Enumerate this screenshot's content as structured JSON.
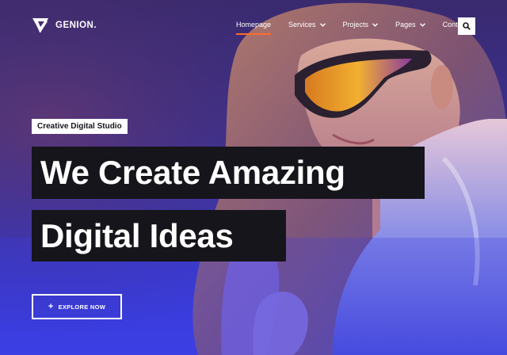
{
  "brand": {
    "name": "GENION."
  },
  "nav": {
    "items": [
      {
        "label": "Homepage",
        "active": true,
        "has_dropdown": false
      },
      {
        "label": "Services",
        "active": false,
        "has_dropdown": true
      },
      {
        "label": "Projects",
        "active": false,
        "has_dropdown": true
      },
      {
        "label": "Pages",
        "active": false,
        "has_dropdown": true
      },
      {
        "label": "Contact",
        "active": false,
        "has_dropdown": false
      }
    ],
    "search_icon": "search-icon"
  },
  "hero": {
    "tagline": "Creative Digital Studio",
    "headline_line1": "We Create Amazing",
    "headline_line2": "Digital Ideas",
    "cta_icon": "+",
    "cta_label": "EXPLORE NOW"
  },
  "colors": {
    "accent": "#ff6a2a",
    "dark": "#16151c",
    "bg_top": "#3a2a6e",
    "bg_bottom": "#3b40e6"
  }
}
